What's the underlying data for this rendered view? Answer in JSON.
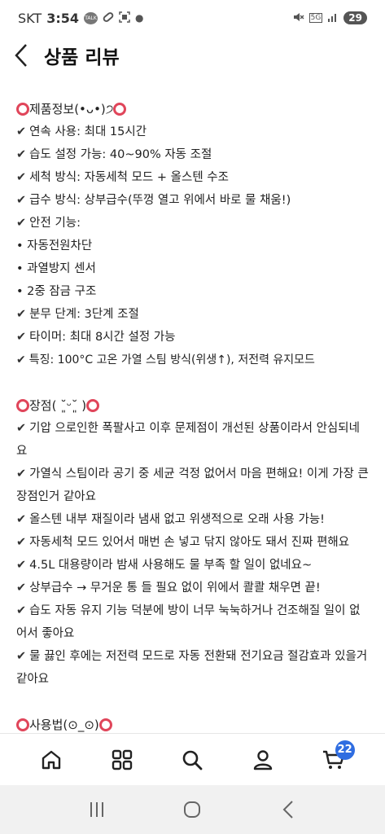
{
  "status_bar": {
    "carrier": "SKT",
    "time": "3:54",
    "talk_badge": "TALK",
    "network": "5G",
    "battery": "29"
  },
  "header": {
    "title": "상품 리뷰"
  },
  "review": {
    "info_title": "제품정보(•ᴗ•)੭",
    "info_lines": [
      "연속 사용: 최대 15시간",
      "습도 설정 가능: 40~90% 자동 조절",
      "세척 방식: 자동세척 모드 + 올스텐 수조",
      "급수 방식: 상부급수(뚜껑 열고 위에서 바로 물 채움!)",
      "안전 기능:"
    ],
    "safety_items": [
      "• 자동전원차단",
      "• 과열방지 센서",
      "• 2중 잠금 구조"
    ],
    "info_lines_2": [
      "분무 단계: 3단계 조절",
      "타이머: 최대 8시간 설정 가능",
      "특징: 100°C 고온 가열 스팀 방식(위생↑), 저전력 유지모드"
    ],
    "pros_title": "장점( ˘͈ᵕ˘͈ )",
    "pros_lines": [
      "기압 으로인한 폭팔사고 이후 문제점이 개선된 상품이라서 안심되네요",
      "가열식 스팀이라 공기 중 세균 걱정 없어서 마음 편해요! 이게 가장 큰 장점인거 같아요",
      "올스텐 내부 재질이라 냄새 없고 위생적으로 오래 사용 가능!",
      "자동세척 모드 있어서 매번 손 넣고 닦지 않아도 돼서 진짜 편해요",
      "4.5L 대용량이라 밤새 사용해도 물 부족 할 일이 없네요~",
      "상부급수 → 무거운 통 들 필요 없이 위에서 콸콸 채우면 끝!",
      "습도 자동 유지 기능 덕분에 방이 너무 눅눅하거나 건조해질 일이 없어서 좋아요",
      "물 끓인 후에는 저전력 모드로 자동 전환돼 전기요금 절감효과 있을거 같아요"
    ],
    "cons_title_partial": "사용법(⊙_⊙)"
  },
  "bottom_nav": {
    "cart_count": "22",
    "icons": [
      "home-icon",
      "category-grid-icon",
      "search-icon",
      "user-icon",
      "cart-icon"
    ]
  },
  "colors": {
    "accent_ring": "#e0455a",
    "cart_badge": "#2f6de1"
  }
}
